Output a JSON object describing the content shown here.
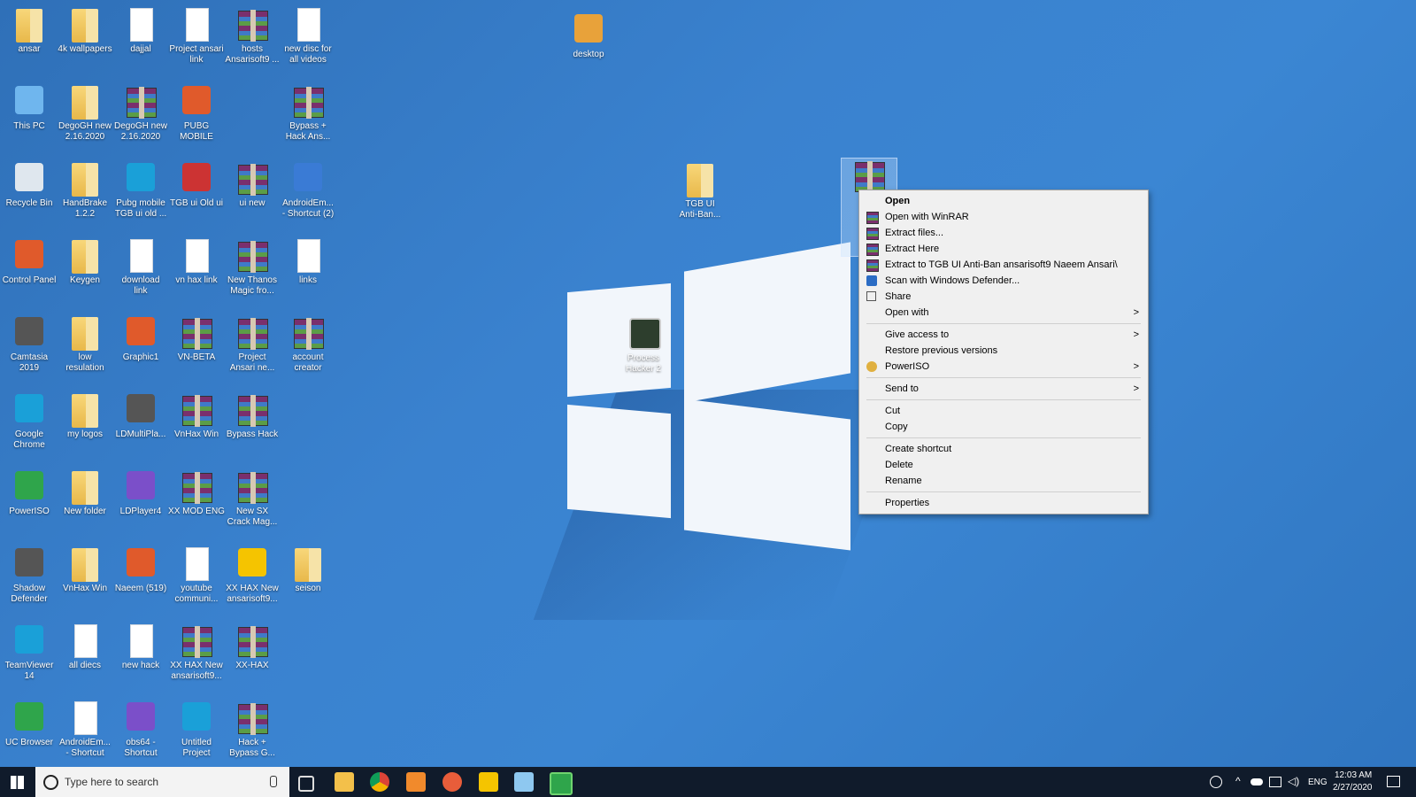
{
  "desktop_icons": [
    {
      "label": "ansar",
      "type": "folder"
    },
    {
      "label": "4k wallpapers",
      "type": "folder"
    },
    {
      "label": "dajjal",
      "type": "doc"
    },
    {
      "label": "Project ansari\nlink",
      "type": "doc"
    },
    {
      "label": "hosts\nAnsarisoft9 ...",
      "type": "rar"
    },
    {
      "label": "new disc for\nall videos",
      "type": "doc"
    },
    {
      "label": "This PC",
      "type": "pc"
    },
    {
      "label": "DegoGH new\n2.16.2020",
      "type": "folder"
    },
    {
      "label": "DegoGH new\n2.16.2020",
      "type": "rar"
    },
    {
      "label": "PUBG\nMOBILE",
      "type": "app"
    },
    {
      "label": "Bypass +\nHack Ans...",
      "type": "rar"
    },
    {
      "label": "Recycle Bin",
      "type": "bin"
    },
    {
      "label": "HandBrake\n1.2.2",
      "type": "folder"
    },
    {
      "label": "Pubg mobile\nTGB ui old ...",
      "type": "app"
    },
    {
      "label": "TGB ui Old ui",
      "type": "app"
    },
    {
      "label": "ui new",
      "type": "rar"
    },
    {
      "label": "AndroidEm...\n- Shortcut (2)",
      "type": "app"
    },
    {
      "label": "Control Panel",
      "type": "app"
    },
    {
      "label": "Keygen",
      "type": "folder"
    },
    {
      "label": "download\nlink",
      "type": "doc"
    },
    {
      "label": "vn hax link",
      "type": "doc"
    },
    {
      "label": "New Thanos\nMagic fro...",
      "type": "rar"
    },
    {
      "label": "links",
      "type": "doc"
    },
    {
      "label": "Camtasia\n2019",
      "type": "app"
    },
    {
      "label": "low\nresulation",
      "type": "folder"
    },
    {
      "label": "Graphic1",
      "type": "app"
    },
    {
      "label": "VN-BETA",
      "type": "rar"
    },
    {
      "label": "Project\nAnsari ne...",
      "type": "rar"
    },
    {
      "label": "account\ncreator",
      "type": "rar"
    },
    {
      "label": "Google\nChrome",
      "type": "app"
    },
    {
      "label": "my logos",
      "type": "folder"
    },
    {
      "label": "LDMultiPla...",
      "type": "app"
    },
    {
      "label": "VnHax Win",
      "type": "rar"
    },
    {
      "label": "Bypass Hack",
      "type": "rar"
    },
    {
      "label": "PowerISO",
      "type": "app"
    },
    {
      "label": "New folder",
      "type": "folder"
    },
    {
      "label": "LDPlayer4",
      "type": "app"
    },
    {
      "label": "XX MOD ENG",
      "type": "rar"
    },
    {
      "label": "New SX\nCrack Mag...",
      "type": "rar"
    },
    {
      "label": "Shadow\nDefender",
      "type": "app"
    },
    {
      "label": "VnHax Win",
      "type": "folder"
    },
    {
      "label": "Naeem (519)",
      "type": "app"
    },
    {
      "label": "youtube\ncommuni...",
      "type": "doc"
    },
    {
      "label": "XX HAX New\nansarisoft9...",
      "type": "app"
    },
    {
      "label": "seison",
      "type": "folder"
    },
    {
      "label": "TeamViewer\n14",
      "type": "app"
    },
    {
      "label": "all diecs",
      "type": "doc"
    },
    {
      "label": "new hack",
      "type": "doc"
    },
    {
      "label": "XX HAX New\nansarisoft9...",
      "type": "rar"
    },
    {
      "label": "XX-HAX",
      "type": "rar"
    },
    {
      "label": "UC Browser",
      "type": "app"
    },
    {
      "label": "AndroidEm...\n- Shortcut",
      "type": "doc"
    },
    {
      "label": "obs64 -\nShortcut",
      "type": "app"
    },
    {
      "label": "Untitled\nProject",
      "type": "app"
    },
    {
      "label": "Hack +\nBypass G...",
      "type": "rar"
    }
  ],
  "extra_icons": {
    "desktop": "desktop",
    "tgb_folder": "TGB UI\nAnti-Ban...",
    "process_hacker": "Process\nHacker 2"
  },
  "context_menu": {
    "open": "Open",
    "open_with_winrar": "Open with WinRAR",
    "extract_files": "Extract files...",
    "extract_here": "Extract Here",
    "extract_to": "Extract to TGB UI Anti-Ban ansarisoft9 Naeem Ansari\\",
    "scan_defender": "Scan with Windows Defender...",
    "share": "Share",
    "open_with": "Open with",
    "give_access": "Give access to",
    "restore_versions": "Restore previous versions",
    "poweriso": "PowerISO",
    "send_to": "Send to",
    "cut": "Cut",
    "copy": "Copy",
    "create_shortcut": "Create shortcut",
    "delete": "Delete",
    "rename": "Rename",
    "properties": "Properties",
    "arrow": ">"
  },
  "taskbar": {
    "search_placeholder": "Type here to search",
    "language": "ENG",
    "time": "12:03 AM",
    "date": "2/27/2020"
  },
  "colors": {
    "desktop_bg": "#3a82cf",
    "taskbar": "#101b2b",
    "menu_bg": "#f0f0f0"
  }
}
